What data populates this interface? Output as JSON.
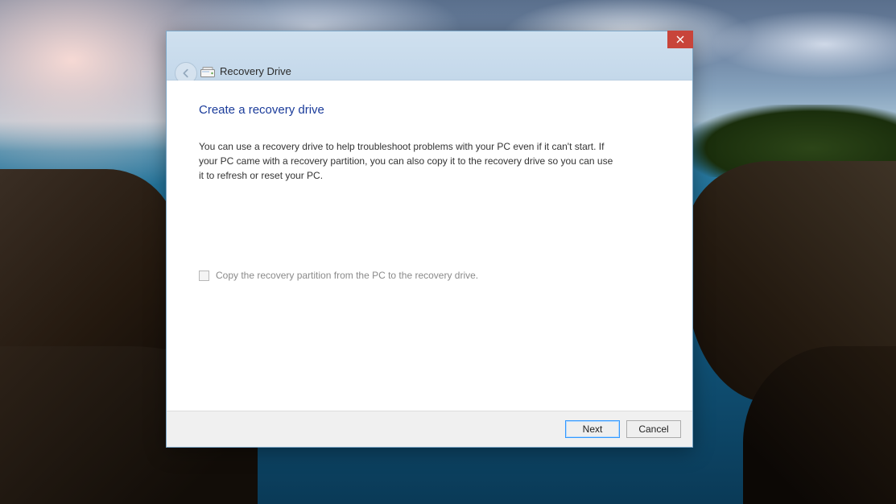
{
  "window": {
    "title": "Recovery Drive"
  },
  "page": {
    "heading": "Create a recovery drive",
    "description": "You can use a recovery drive to help troubleshoot problems with your PC even if it can't start. If your PC came with a recovery partition, you can also copy it to the recovery drive so you can use it to refresh or reset your PC."
  },
  "options": {
    "copy_partition_label": "Copy the recovery partition from the PC to the recovery drive.",
    "copy_partition_checked": false,
    "copy_partition_enabled": false
  },
  "buttons": {
    "next": "Next",
    "cancel": "Cancel"
  }
}
